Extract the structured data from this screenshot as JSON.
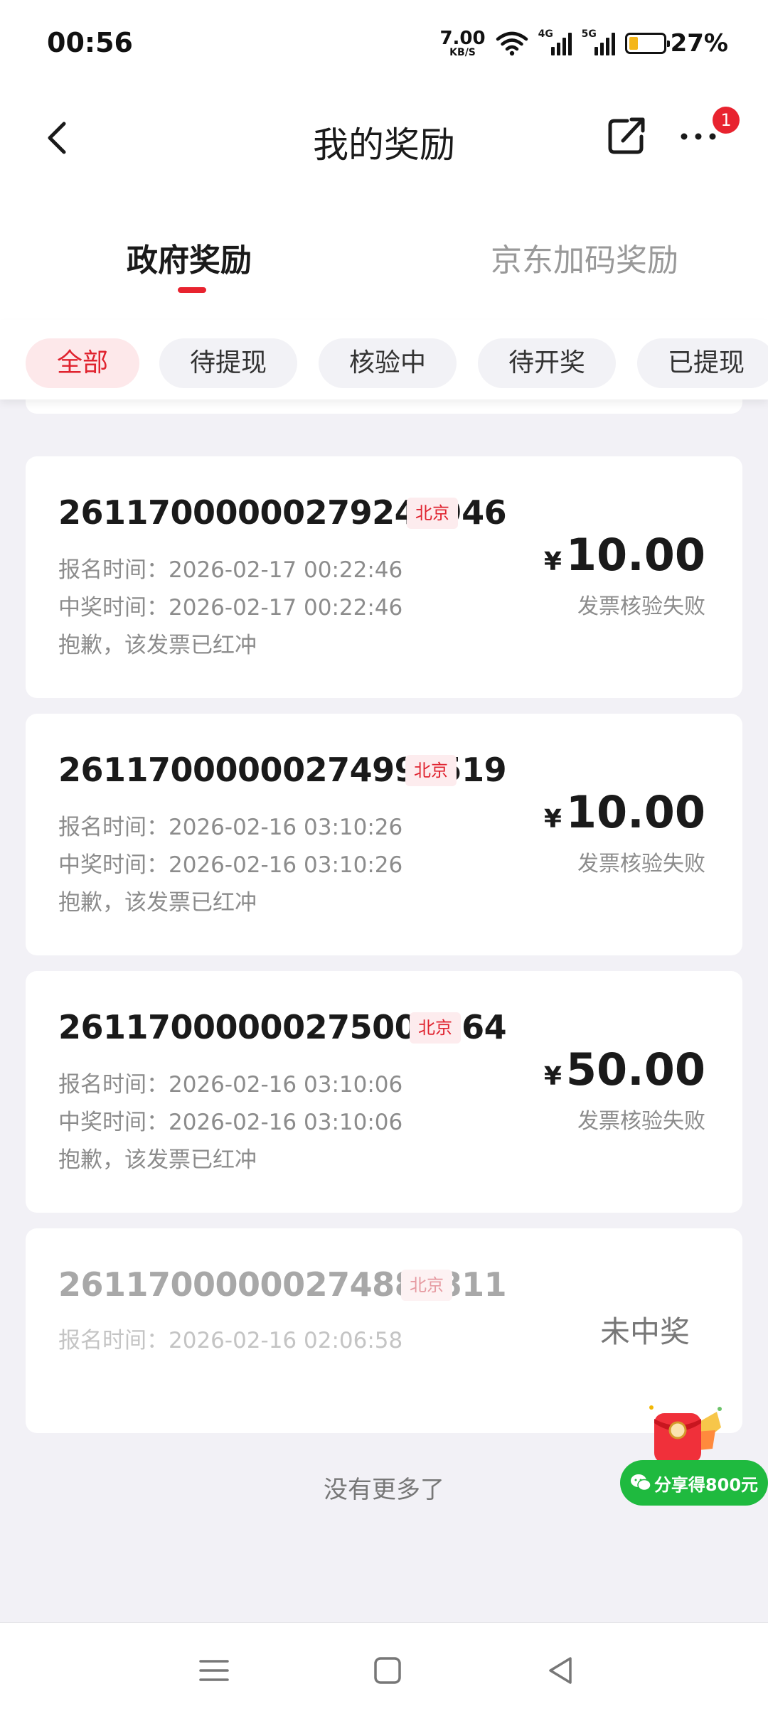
{
  "status_bar": {
    "time": "00:56",
    "net_speed_value": "7.00",
    "net_speed_unit": "KB/S",
    "sim1_label": "4G",
    "sim2_label": "5G",
    "battery_percent": "27%",
    "battery_level": 0.27
  },
  "header": {
    "title": "我的奖励",
    "more_badge": "1"
  },
  "tabs": [
    {
      "label": "政府奖励",
      "active": true
    },
    {
      "label": "京东加码奖励",
      "active": false
    }
  ],
  "filters": [
    {
      "label": "全部",
      "active": true
    },
    {
      "label": "待提现",
      "active": false
    },
    {
      "label": "核验中",
      "active": false
    },
    {
      "label": "待开奖",
      "active": false
    },
    {
      "label": "已提现",
      "active": false
    }
  ],
  "rewards": [
    {
      "order_no": "26117000000279241946",
      "region": "北京",
      "signup_label": "报名时间：",
      "signup_time": "2026-02-17 00:22:46",
      "win_label": "中奖时间：",
      "win_time": "2026-02-17 00:22:46",
      "note": "抱歉，该发票已红冲",
      "currency": "¥",
      "amount": "10.00",
      "status": "发票核验失败"
    },
    {
      "order_no": "26117000000274998519",
      "region": "北京",
      "signup_label": "报名时间：",
      "signup_time": "2026-02-16 03:10:26",
      "win_label": "中奖时间：",
      "win_time": "2026-02-16 03:10:26",
      "note": "抱歉，该发票已红冲",
      "currency": "¥",
      "amount": "10.00",
      "status": "发票核验失败"
    },
    {
      "order_no": "26117000000275000664",
      "region": "北京",
      "signup_label": "报名时间：",
      "signup_time": "2026-02-16 03:10:06",
      "win_label": "中奖时间：",
      "win_time": "2026-02-16 03:10:06",
      "note": "抱歉，该发票已红冲",
      "currency": "¥",
      "amount": "50.00",
      "status": "发票核验失败"
    },
    {
      "order_no": "26117000000274880811",
      "region": "北京",
      "signup_label": "报名时间：",
      "signup_time": "2026-02-16 02:06:58",
      "result": "未中奖"
    }
  ],
  "footer_text": "没有更多了",
  "float_share": {
    "label": "分享得800元"
  },
  "colors": {
    "accent_red": "#e8232f",
    "share_green": "#1fba3f",
    "page_bg": "#f2f1f6"
  }
}
